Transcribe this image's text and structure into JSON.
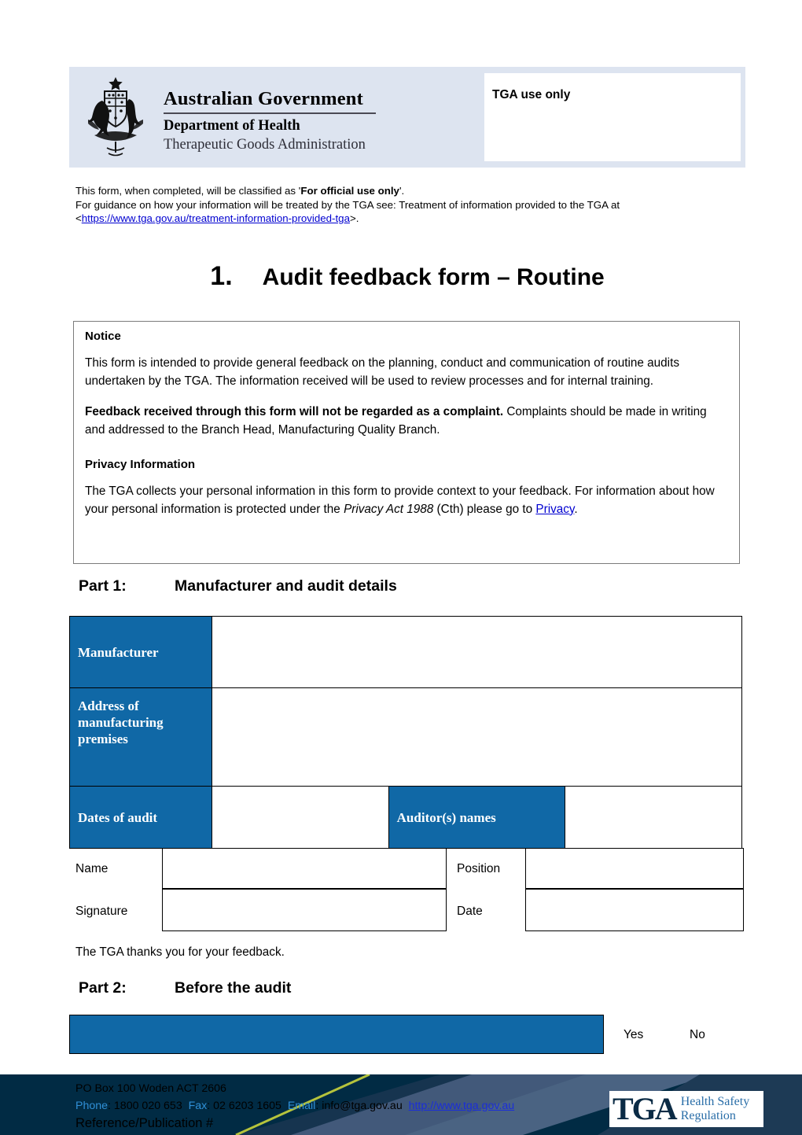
{
  "header": {
    "crest_alt": "australian-coat-of-arms",
    "gov_line1": "Australian Government",
    "gov_line2": "Department of Health",
    "gov_line3": "Therapeutic Goods Administration",
    "tga_use_only": "TGA use only"
  },
  "classification": {
    "line1_pre": "This form, when completed, will be classified as '",
    "line1_bold": "For official use only",
    "line1_post": "'.",
    "line2": "For guidance on how your information will be treated by the TGA see: Treatment of information provided to the TGA at",
    "line3_pre": "<",
    "line3_link": "https://www.tga.gov.au/treatment-information-provided-tga",
    "line3_post": ">."
  },
  "title": {
    "number": "1.",
    "text": "Audit feedback form – Routine"
  },
  "notice": {
    "heading": "Notice",
    "paragraph1": "This form is intended to provide general feedback on the planning, conduct and communication of routine audits undertaken by the TGA. The information received will be used to review processes and for internal training.",
    "paragraph2_bold": "Feedback received through this form will not be regarded as a complaint.",
    "paragraph2_rest": " Complaints should be made in writing and addressed to the Branch Head, Manufacturing Quality Branch.",
    "privacy_heading": "Privacy Information",
    "privacy_pre": "The TGA collects your personal information in this form to provide context to your feedback. For information about how your personal information is protected under the ",
    "privacy_italic": "Privacy Act 1988",
    "privacy_mid": " (Cth) please go to ",
    "privacy_link": "Privacy",
    "privacy_post": "."
  },
  "part1": {
    "label": "Part 1:",
    "title": "Manufacturer and audit details",
    "rows": {
      "manufacturer_label": "Manufacturer",
      "manufacturer_value": "",
      "address_label": "Address of manufacturing premises",
      "address_value": "",
      "dates_label": "Dates of audit",
      "dates_value": "",
      "auditors_label": "Auditor(s) names",
      "auditors_value": ""
    }
  },
  "signature_block": {
    "name_label": "Name",
    "name_value": "",
    "position_label": "Position",
    "position_value": "",
    "signature_label": "Signature",
    "signature_value": "",
    "date_label": "Date",
    "date_value": "",
    "thanks": "The TGA thanks you for your feedback."
  },
  "part2": {
    "label": "Part 2:",
    "title": "Before the audit",
    "bar_text": "",
    "yes_label": "Yes",
    "no_label": "No"
  },
  "footer": {
    "address": "PO Box 100  Woden ACT 2606",
    "phone_key": "Phone",
    "phone_sep": ": ",
    "phone_value": "1800 020 653",
    "fax_key": "Fax",
    "fax_value": "02 6203 1605",
    "email_key": "Email",
    "email_value": "info@tga.gov.au",
    "website": "http://www.tga.gov.au",
    "reference": "Reference/Publication #",
    "logo_mark": "TGA",
    "logo_tag_line1": "Health Safety",
    "logo_tag_line2": "Regulation"
  },
  "colors": {
    "header_band": "#dde4f0",
    "table_blue": "#1068a6",
    "footer_navy": "#012b44",
    "link_blue": "#0000d0",
    "footer_key_blue": "#2f8fd6",
    "footer_accent_green": "#b5c33c"
  }
}
